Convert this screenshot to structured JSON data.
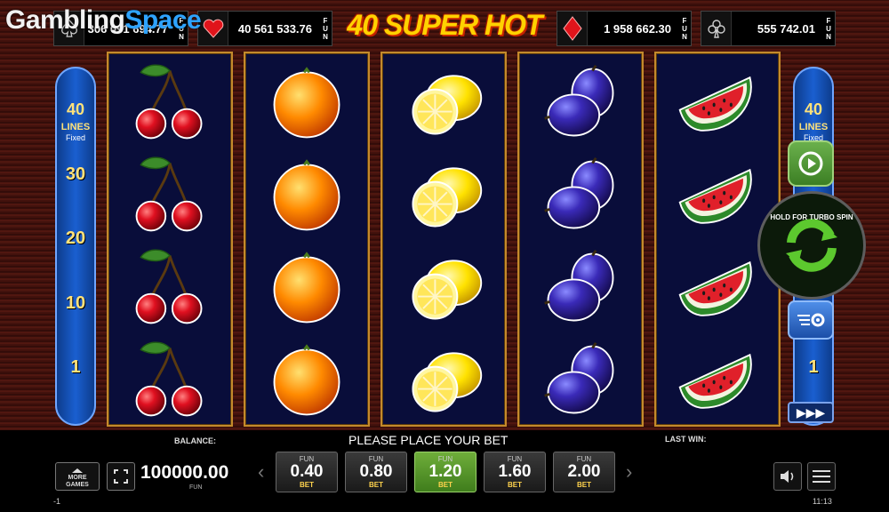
{
  "watermark": {
    "part1": "Gambling",
    "part2": "Space"
  },
  "header": {
    "title": "40 SUPER HOT",
    "jackpots": [
      {
        "suit": "spade-icon",
        "value": "306 091 694.77",
        "fun": "FUN"
      },
      {
        "suit": "heart-icon",
        "value": "40 561 533.76",
        "fun": "FUN"
      },
      {
        "suit": "diamond-icon",
        "value": "1 958 662.30",
        "fun": "FUN"
      },
      {
        "suit": "club-icon",
        "value": "555 742.01",
        "fun": "FUN"
      }
    ]
  },
  "lines": {
    "count": "40",
    "label": "LINES",
    "fixed": "Fixed",
    "markers": [
      "30",
      "20",
      "10",
      "1"
    ]
  },
  "reels": [
    [
      "cherry",
      "cherry",
      "cherry",
      "cherry"
    ],
    [
      "orange",
      "orange",
      "orange",
      "orange"
    ],
    [
      "lemon",
      "lemon",
      "lemon",
      "lemon"
    ],
    [
      "plum",
      "plum",
      "plum",
      "plum"
    ],
    [
      "watermelon",
      "watermelon",
      "watermelon",
      "watermelon"
    ]
  ],
  "controls": {
    "turbo_text": "HOLD FOR TURBO SPIN",
    "autoplay_label": "▶▶▶"
  },
  "bottom": {
    "balance_label": "BALANCE:",
    "status": "PLEASE PLACE YOUR BET",
    "last_win_label": "LAST WIN:",
    "more_games": "MORE GAMES",
    "balance_value": "100000.00",
    "balance_unit": "FUN",
    "bets": [
      {
        "fun": "FUN",
        "value": "0.40",
        "bet": "BET",
        "selected": false
      },
      {
        "fun": "FUN",
        "value": "0.80",
        "bet": "BET",
        "selected": false
      },
      {
        "fun": "FUN",
        "value": "1.20",
        "bet": "BET",
        "selected": true
      },
      {
        "fun": "FUN",
        "value": "1.60",
        "bet": "BET",
        "selected": false
      },
      {
        "fun": "FUN",
        "value": "2.00",
        "bet": "BET",
        "selected": false
      }
    ],
    "footer_left": "-1",
    "footer_time": "11:13"
  },
  "colors": {
    "title": "#ffd200",
    "lines_panel": "#1a5fd0",
    "bet_selected": "#5a9a2a",
    "reel_border": "#c48a2c"
  }
}
